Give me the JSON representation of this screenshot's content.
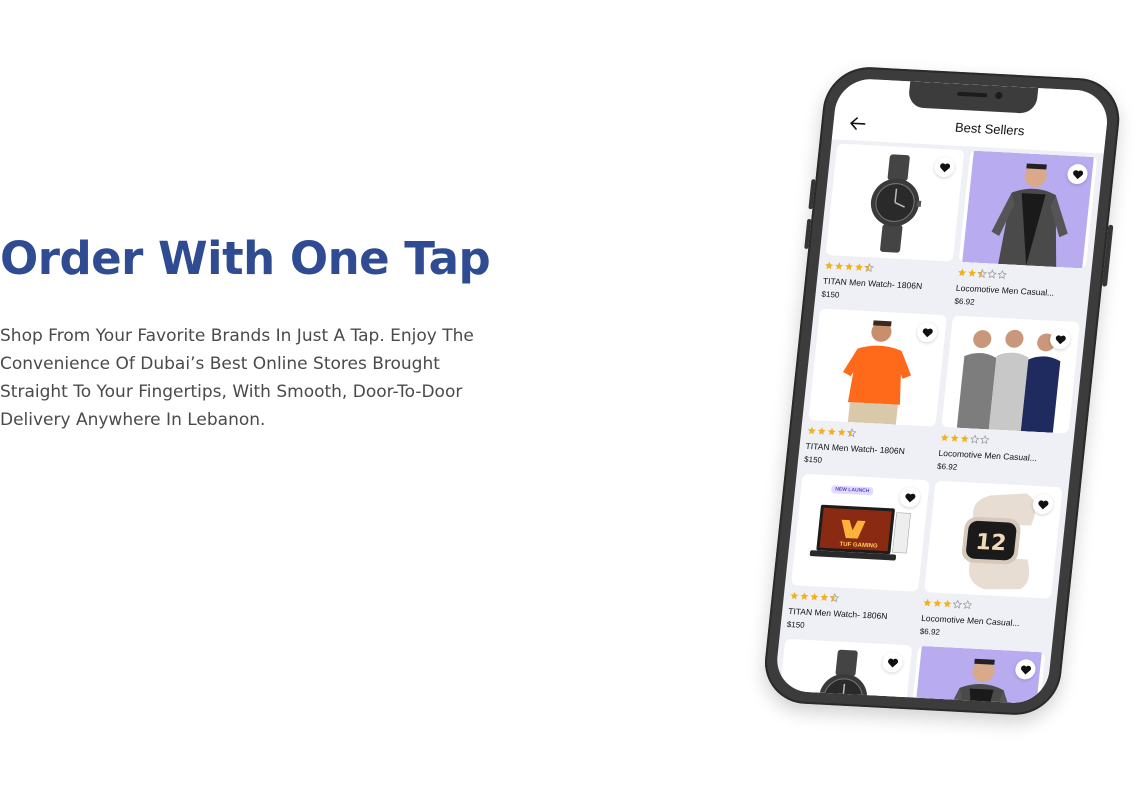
{
  "hero": {
    "title": "Order With One Tap",
    "description": "Shop From Your Favorite Brands In Just A Tap. Enjoy The Convenience Of Dubai’s Best Online Stores Brought Straight To Your Fingertips, With Smooth, Door-To-Door Delivery Anywhere In Lebanon."
  },
  "app": {
    "title": "Best Sellers",
    "back_icon": "arrow-left-icon",
    "favorite_icon": "heart-icon",
    "star_color": "#f2b01e",
    "products": [
      {
        "name": "TITAN Men Watch- 1806N",
        "price": "$150",
        "rating": 4.5,
        "image": "wristwatch",
        "label": ""
      },
      {
        "name": "Locomotive Men Casual...",
        "price": "$6.92",
        "rating": 2.5,
        "image": "checked-shirt-model",
        "label": ""
      },
      {
        "name": "TITAN Men Watch- 1806N",
        "price": "$150",
        "rating": 4.5,
        "image": "orange-polo-model",
        "label": ""
      },
      {
        "name": "Locomotive Men Casual...",
        "price": "$6.92",
        "rating": 3,
        "image": "three-tshirt-models",
        "label": ""
      },
      {
        "name": "TITAN Men Watch- 1806N",
        "price": "$150",
        "rating": 4.5,
        "image": "gaming-laptop",
        "label": "NEW LAUNCH",
        "brand": "TUF GAMING"
      },
      {
        "name": "Locomotive Men Casual...",
        "price": "$6.92",
        "rating": 3,
        "image": "smartwatch",
        "label": ""
      },
      {
        "name": "",
        "price": "",
        "rating": 0,
        "image": "wristwatch",
        "label": ""
      },
      {
        "name": "",
        "price": "",
        "rating": 0,
        "image": "checked-shirt-model",
        "label": ""
      }
    ]
  },
  "colors": {
    "heading": "#2f4b91",
    "body_text": "#4a4a4a",
    "phone_frame": "#3c3c3c",
    "screen_bg": "#eef0f6",
    "lavender": "#b8abf0"
  }
}
